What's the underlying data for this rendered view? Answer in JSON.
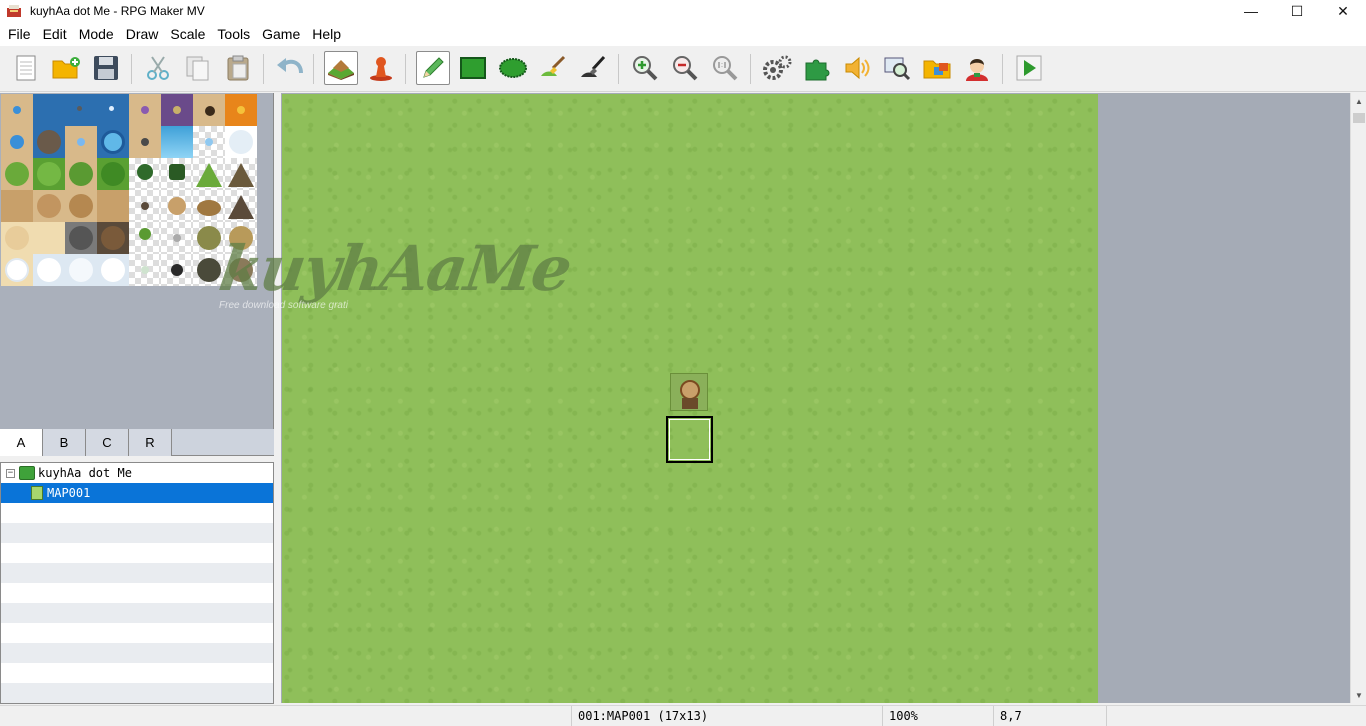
{
  "window": {
    "title": "kuyhAa dot Me - RPG Maker MV",
    "minimize_glyph": "—",
    "maximize_glyph": "☐",
    "close_glyph": "✕"
  },
  "menu": [
    "File",
    "Edit",
    "Mode",
    "Draw",
    "Scale",
    "Tools",
    "Game",
    "Help"
  ],
  "toolbar": {
    "groups": [
      [
        "new-project-icon",
        "open-project-icon",
        "save-project-icon"
      ],
      [
        "cut-icon",
        "copy-icon",
        "paste-icon"
      ],
      [
        "undo-icon"
      ],
      [
        "map-mode-icon",
        "event-mode-icon"
      ],
      [
        "pencil-icon",
        "rectangle-icon",
        "ellipse-icon",
        "fill-icon",
        "shadow-pen-icon"
      ],
      [
        "zoom-in-icon",
        "zoom-out-icon",
        "actual-size-icon"
      ],
      [
        "database-icon",
        "plugin-manager-icon",
        "sound-test-icon",
        "event-searcher-icon",
        "resource-manager-icon",
        "character-generator-icon"
      ],
      [
        "playtest-icon"
      ]
    ],
    "active": [
      "map-mode-icon",
      "pencil-icon"
    ]
  },
  "tabs": [
    "A",
    "B",
    "C",
    "R"
  ],
  "selected_tab": "A",
  "map_tree": {
    "project": "kuyhAa dot Me",
    "toggle_glyph": "−",
    "maps": [
      "MAP001"
    ]
  },
  "watermark": {
    "text": "kuyhAaMe",
    "subtext": "Free download software grati"
  },
  "status": {
    "map": "001:MAP001 (17x13)",
    "zoom": "100%",
    "coords": "8,7"
  },
  "colors": {
    "selection": "#0a74d8",
    "grass": "#8fbf5a",
    "map_background": "#a5abb6"
  }
}
